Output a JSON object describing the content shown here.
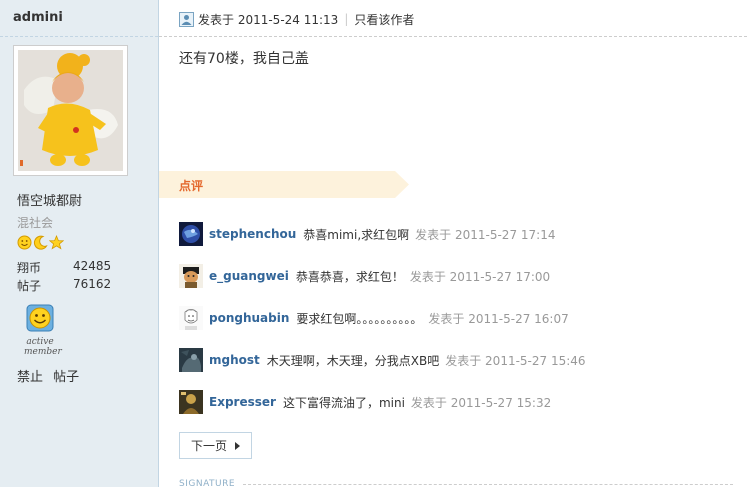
{
  "user": {
    "name": "admini",
    "title": "悟空城都尉",
    "group": "混社会",
    "stats": [
      {
        "label": "翔币",
        "value": "42485"
      },
      {
        "label": "帖子",
        "value": "76162"
      }
    ],
    "medal_text": "active member",
    "actions": [
      "禁止",
      "帖子"
    ]
  },
  "post": {
    "posted_at": "发表于 2011-5-24 11:13",
    "only_author": "只看该作者",
    "content": "还有70楼，我自己盖"
  },
  "rating": {
    "title": "点评",
    "comments": [
      {
        "user": "stephenchou",
        "text": "恭喜mimi,求红包啊",
        "time": "发表于 2011-5-27 17:14"
      },
      {
        "user": "e_guangwei",
        "text": "恭喜恭喜，求红包！",
        "time": "发表于 2011-5-27 17:00"
      },
      {
        "user": "ponghuabin",
        "text": "要求红包啊。。。。。。。。。。",
        "time": "发表于 2011-5-27 16:07"
      },
      {
        "user": "mghost",
        "text": "木天理啊，木天理，分我点XB吧",
        "time": "发表于 2011-5-27 15:46"
      },
      {
        "user": "Expresser",
        "text": "这下富得流油了，mini",
        "time": "发表于 2011-5-27 15:32"
      }
    ],
    "next_page": "下一页"
  },
  "signature_label": "SIGNATURE",
  "colors": {
    "sidebar_bg": "#e5edf2",
    "link_blue": "#336699",
    "rating_orange": "#e4682d",
    "rating_tab_bg": "#fdf2dc"
  }
}
